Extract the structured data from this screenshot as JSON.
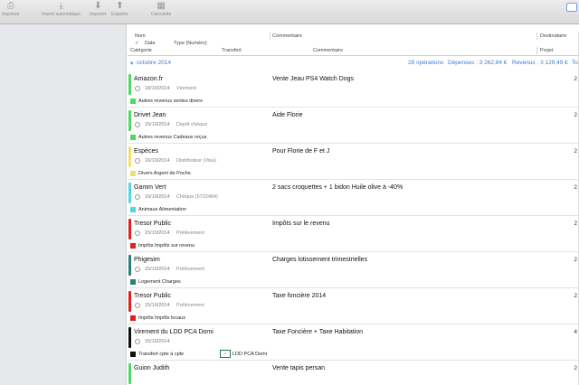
{
  "toolbar": {
    "print_label": "Imprimer",
    "auto_import_label": "Import automatique",
    "import_label": "Importer",
    "export_label": "Exporter",
    "calculator_label": "Calculette"
  },
  "columns": {
    "nom": "Nom",
    "date": "Date",
    "type": "Type (Numéro)",
    "commentaire": "Commentaire",
    "destinataire": "Destinataire",
    "categorie": "Catégorie",
    "transfert": "Transfert",
    "commentaire2": "Commentaire",
    "projet": "Projet",
    "check": "✓"
  },
  "month": {
    "label": "octobre 2014",
    "operations": "28 opérations",
    "depenses": "Dépenses : 3 262,84 €",
    "revenus": "Revenus : 3 129,49 €",
    "total": "To"
  },
  "colors": {
    "green": "#4cd964",
    "yellow": "#f2e06a",
    "cyan": "#4fd7dd",
    "red": "#e0201f",
    "teal": "#2a7f7a",
    "black": "#111111",
    "link": "#3b7fcf"
  },
  "transactions": [
    {
      "payee": "Amazon.fr",
      "date": "18/10/2014",
      "type": "Virement",
      "comment": "Vente Jeau PS4 Watch Dogs",
      "amount": "2",
      "category": "Autres revenus ventes divers",
      "color": "#4cd964",
      "transfer": ""
    },
    {
      "payee": "Drivet Jean",
      "date": "16/10/2014",
      "type": "Dépôt chèque",
      "comment": "Aide Florie",
      "amount": "2",
      "category": "Autres revenus Cadeaux reçus",
      "color": "#4cd964",
      "transfer": ""
    },
    {
      "payee": "Espèces",
      "date": "16/10/2014",
      "type": "Distributeur (Visa)",
      "comment": "Pour Florie de F et J",
      "amount": "2",
      "category": "Divers Argent de Poche",
      "color": "#f2e06a",
      "transfer": ""
    },
    {
      "payee": "Gamm Vert",
      "date": "16/10/2014",
      "type": "Chèque (5722484)",
      "comment": "2 sacs croquettes + 1 bidon Huile olive à -40%",
      "amount": "2",
      "category": "Animaux Alimentation",
      "color": "#4fd7dd",
      "transfer": ""
    },
    {
      "payee": "Tresor Public",
      "date": "15/10/2014",
      "type": "Prélèvement",
      "comment": "Impôts sur le revenu",
      "amount": "2",
      "category": "Impôts Impôts sur revenu",
      "color": "#e0201f",
      "transfer": ""
    },
    {
      "payee": "Phigesim",
      "date": "15/10/2014",
      "type": "Prélèvement",
      "comment": "Charges lotissement trimestrielles",
      "amount": "2",
      "category": "Logement Charges",
      "color": "#2a7f7a",
      "transfer": ""
    },
    {
      "payee": "Tresor Public",
      "date": "15/10/2014",
      "type": "Prélèvement",
      "comment": "Taxe foncière 2014",
      "amount": "2",
      "category": "Impôts Impôts locaux",
      "color": "#e0201f",
      "transfer": ""
    },
    {
      "payee": "Virement du LDD PCA Domi",
      "date": "15/10/2014",
      "type": "",
      "comment": "Taxe Foncière + Taxe Habitation",
      "amount": "4",
      "category": "Transfert cpte à cpte",
      "color": "#111111",
      "transfer": "LDD PCA Domi"
    },
    {
      "payee": "Guion Judith",
      "date": "",
      "type": "",
      "comment": "Vente tapis persan",
      "amount": "2",
      "category": "",
      "color": "#4cd964",
      "transfer": ""
    }
  ]
}
